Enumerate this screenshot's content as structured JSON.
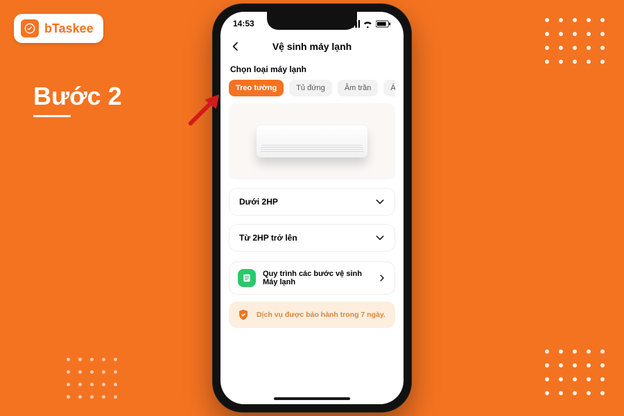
{
  "brand": {
    "name": "bTaskee"
  },
  "step_label": "Bước 2",
  "phone": {
    "status_time": "14:53",
    "battery": "80",
    "title": "Vệ sinh máy lạnh",
    "section_title": "Chọn loại máy lạnh",
    "chips": [
      {
        "label": "Treo tường",
        "active": true
      },
      {
        "label": "Tủ đứng",
        "active": false
      },
      {
        "label": "Âm trần",
        "active": false
      },
      {
        "label": "Áp trần",
        "active": false
      }
    ],
    "options": [
      {
        "label": "Dưới 2HP"
      },
      {
        "label": "Từ 2HP trở lên"
      }
    ],
    "process_link": "Quy trình các bước vệ sinh Máy lạnh",
    "warranty": "Dịch vụ được bảo hành trong 7 ngày."
  }
}
